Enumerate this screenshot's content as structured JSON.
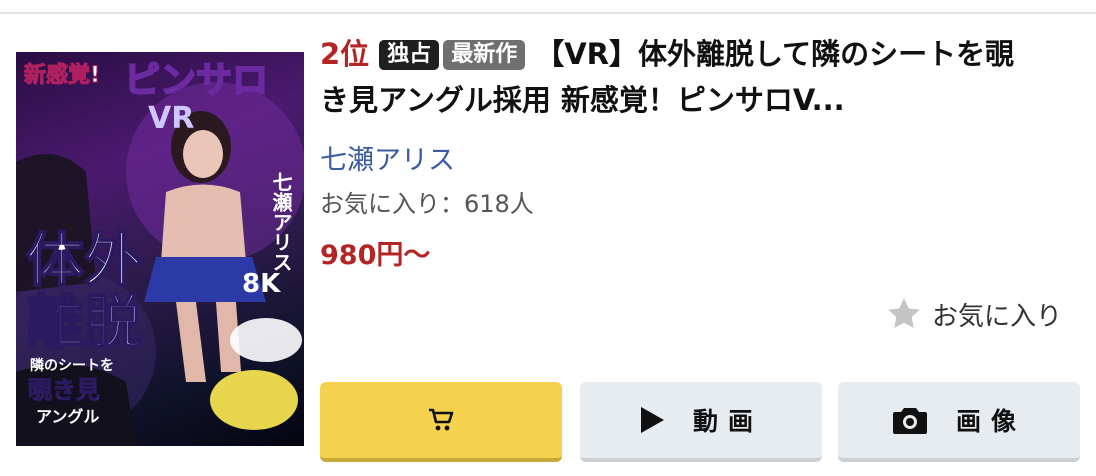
{
  "product": {
    "rank": "2位",
    "badges": {
      "exclusive": "独占",
      "new": "最新作"
    },
    "title_line1": "【VR】体外離脱して隣のシートを覗",
    "title_line2": "き見アングル採用 新感覚！ピンサロV...",
    "actress": "七瀬アリス",
    "favorites": "お気に入り：618人",
    "price": "980円～",
    "favorite_button_label": "お気に入り",
    "cover_art_text": {
      "headline_top": "新感覚!",
      "brand": "ピンサロ",
      "vr": "VR",
      "big1": "体外",
      "big2": "離脱",
      "vertical_name": "七瀬アリス",
      "sub1": "隣のシートを",
      "sub2": "覗き見",
      "sub3": "アングル",
      "res": "8K"
    }
  },
  "actions": {
    "cart_label": "",
    "video_label": "動画",
    "image_label": "画像"
  },
  "colors": {
    "rank": "#b52424",
    "price": "#b52424",
    "actress_link": "#3b5ca0",
    "cart_button": "#f4d24d",
    "secondary_button": "#e7ecf0"
  },
  "icons": {
    "favorite": "star-icon",
    "cart": "cart-icon",
    "video": "play-icon",
    "image": "camera-icon"
  }
}
